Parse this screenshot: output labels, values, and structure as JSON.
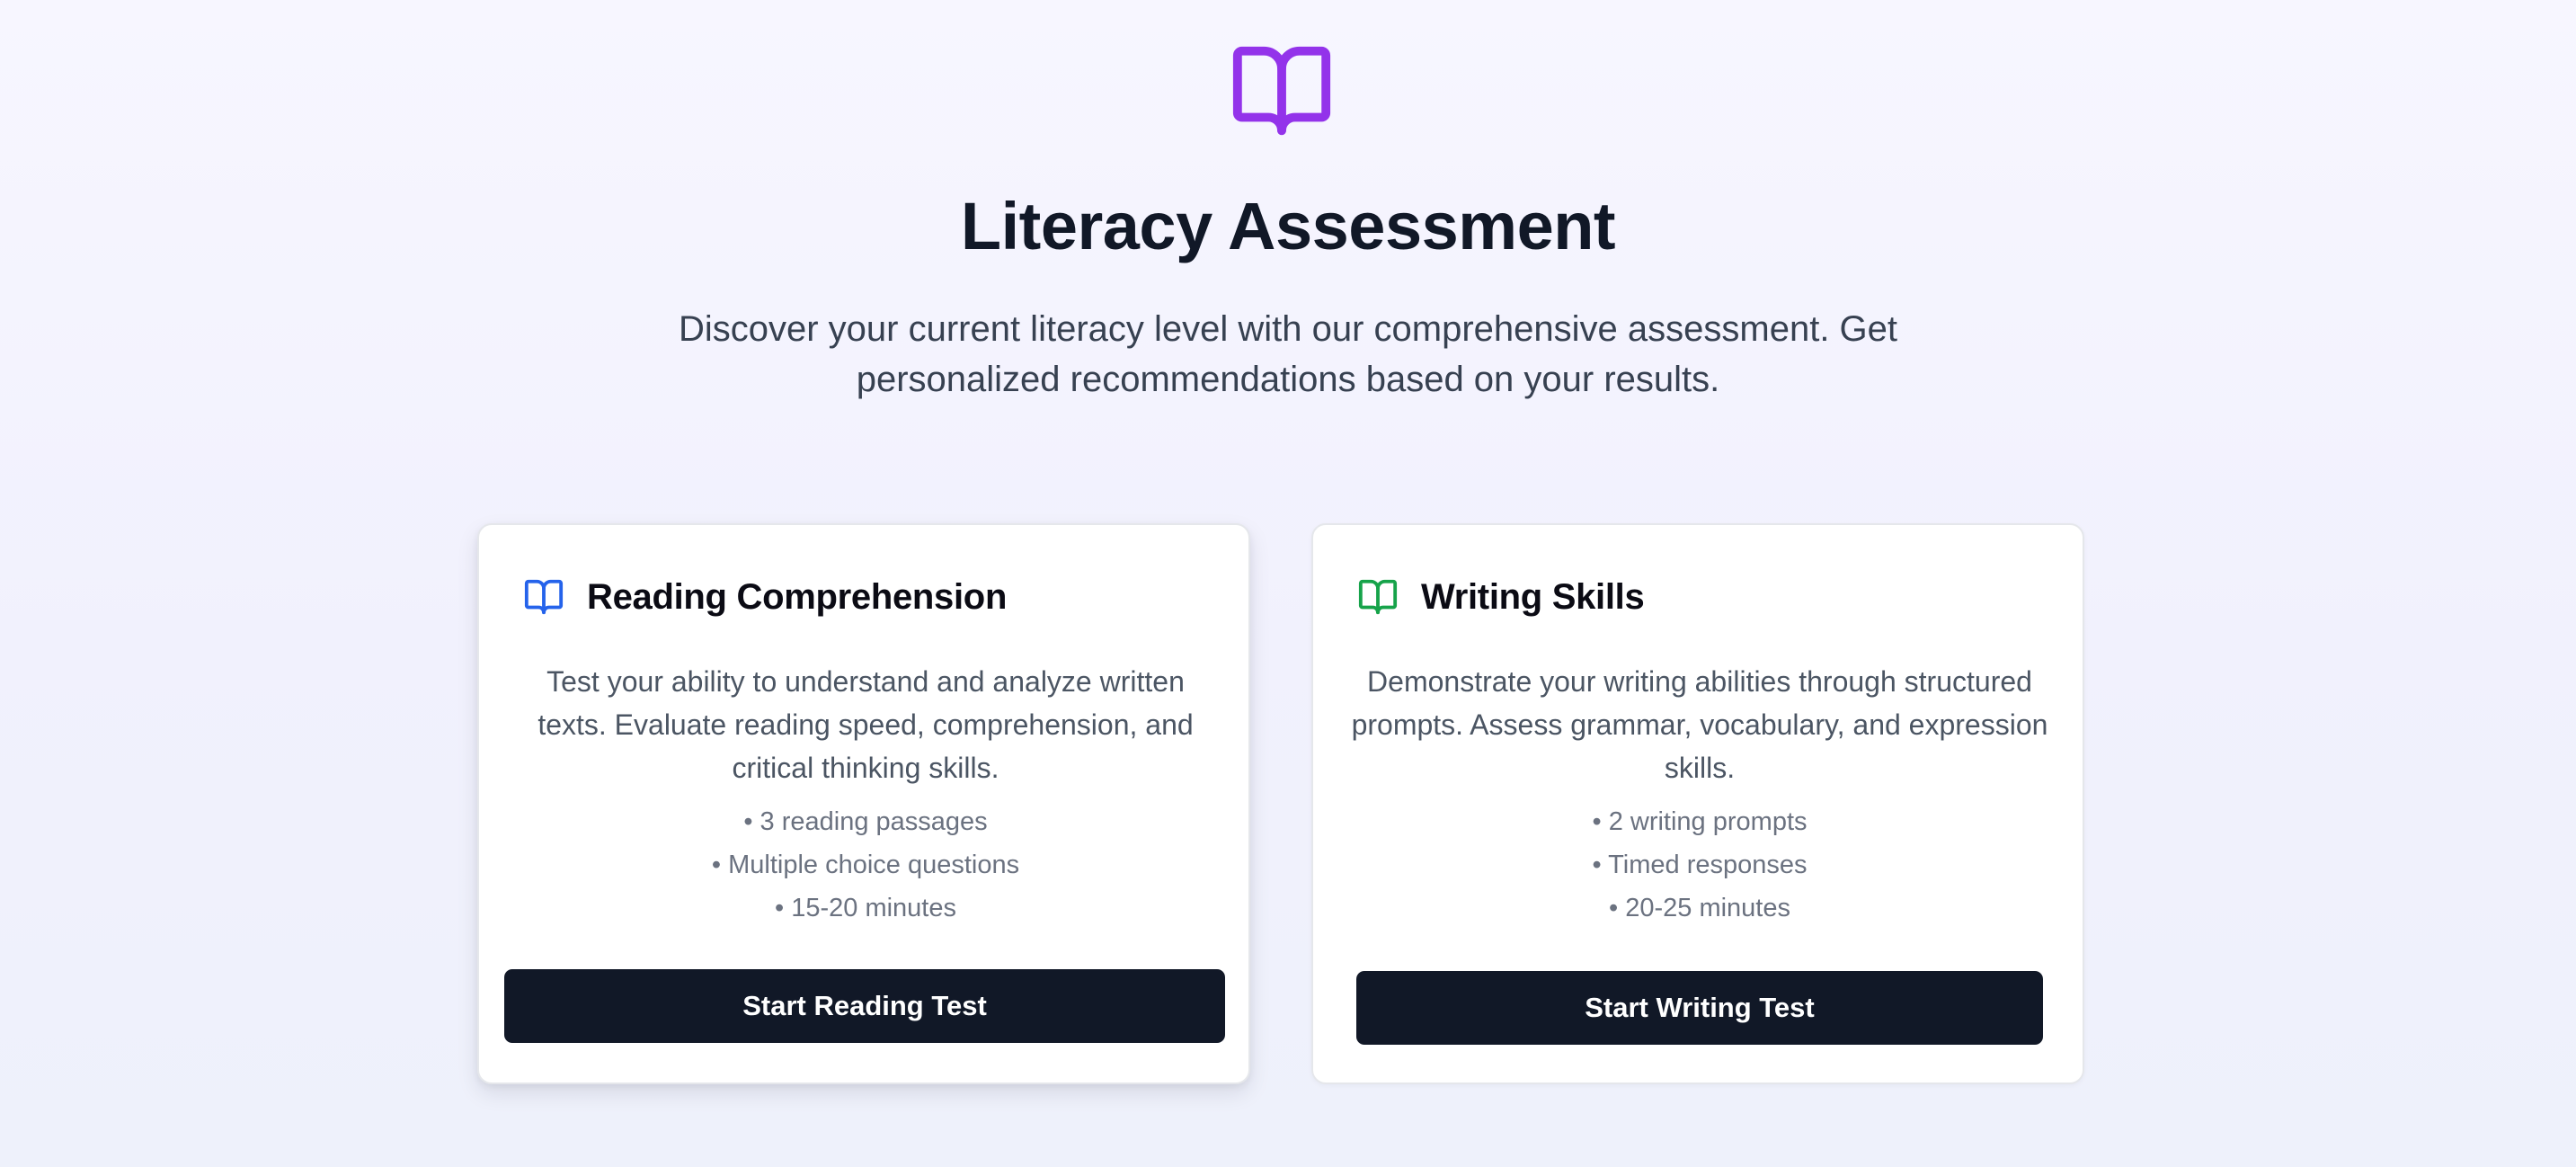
{
  "hero": {
    "icon": "open-book-icon",
    "title": "Literacy Assessment",
    "subtitle": "Discover your current literacy level with our comprehensive assessment. Get personalized recommendations based on your results."
  },
  "colors": {
    "accent_purple": "#9333ea",
    "reading_blue": "#2563eb",
    "writing_green": "#16a34a",
    "button_dark": "#111827"
  },
  "cards": [
    {
      "icon": "book-icon",
      "title": "Reading Comprehension",
      "description": "Test your ability to understand and analyze written texts. Evaluate reading speed, comprehension, and critical thinking skills.",
      "features": [
        "3 reading passages",
        "Multiple choice questions",
        "15-20 minutes"
      ],
      "button_label": "Start Reading Test"
    },
    {
      "icon": "book-icon",
      "title": "Writing Skills",
      "description": "Demonstrate your writing abilities through structured prompts. Assess grammar, vocabulary, and expression skills.",
      "features": [
        "2 writing prompts",
        "Timed responses",
        "20-25 minutes"
      ],
      "button_label": "Start Writing Test"
    }
  ]
}
